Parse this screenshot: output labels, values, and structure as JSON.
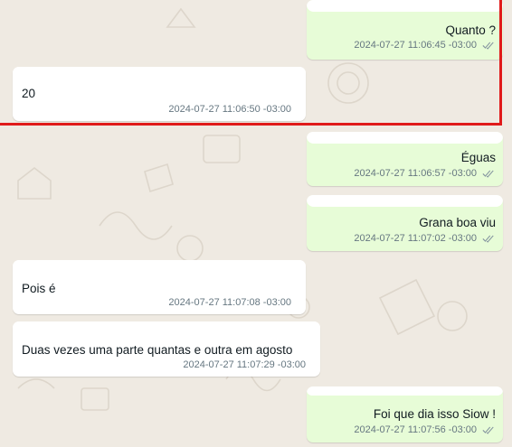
{
  "messages": [
    {
      "text": "Quanto ?",
      "time": "2024-07-27 11:06:45 -03:00",
      "dir": "out"
    },
    {
      "text": "20",
      "time": "2024-07-27 11:06:50 -03:00",
      "dir": "in"
    },
    {
      "text": "Éguas",
      "time": "2024-07-27 11:06:57 -03:00",
      "dir": "out"
    },
    {
      "text": "Grana boa viu",
      "time": "2024-07-27 11:07:02 -03:00",
      "dir": "out"
    },
    {
      "text": "Pois é",
      "time": "2024-07-27 11:07:08 -03:00",
      "dir": "in"
    },
    {
      "text": "Duas vezes uma parte quantas e outra em agosto",
      "time": "2024-07-27 11:07:29 -03:00",
      "dir": "in"
    },
    {
      "text": "Foi que dia isso Siow !",
      "time": "2024-07-27 11:07:56 -03:00",
      "dir": "out"
    }
  ],
  "colors": {
    "wallpaper": "#efeae2",
    "outgoing_bubble": "#e7fcd7",
    "incoming_bubble": "#ffffff",
    "highlight_box": "#e01a1a",
    "read_ticks": "#8696a0"
  },
  "icons": {
    "delivered": "double-check-icon"
  }
}
